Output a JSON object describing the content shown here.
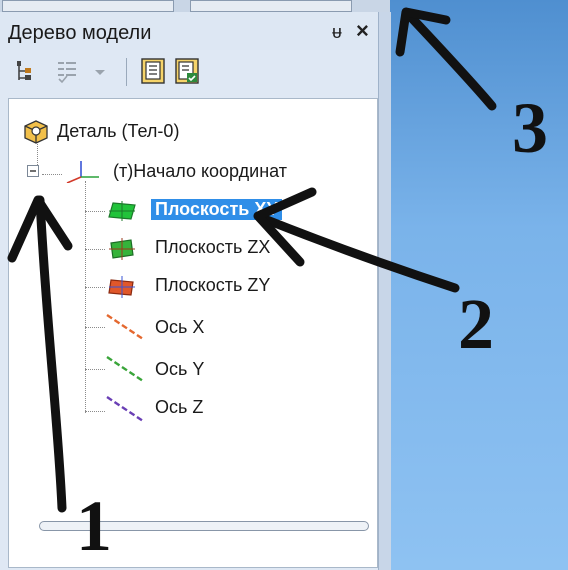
{
  "panel": {
    "title": "Дерево модели",
    "pin_glyph": "ᵾ",
    "close_glyph": "×"
  },
  "toolbar": {
    "icons": [
      "tree-structure-icon",
      "filter-list-icon",
      "dropdown-arrow-icon",
      "document-icon",
      "rebuild-icon"
    ]
  },
  "tree": {
    "root": {
      "label": "Деталь (Тел-0)",
      "icon": "part-cube-icon"
    },
    "origin": {
      "label": "(т)Начало координат",
      "icon": "axes-origin-icon"
    },
    "children": [
      {
        "label": "Плоскость XY",
        "icon": "plane-xy-icon",
        "color": "#21c33a",
        "selected": true
      },
      {
        "label": "Плоскость ZX",
        "icon": "plane-zx-icon",
        "color": "#35b33a",
        "selected": false
      },
      {
        "label": "Плоскость ZY",
        "icon": "plane-zy-icon",
        "color": "#e0572a",
        "selected": false
      },
      {
        "label": "Ось X",
        "icon": "axis-x-icon",
        "color": "#e4682f",
        "selected": false
      },
      {
        "label": "Ось Y",
        "icon": "axis-y-icon",
        "color": "#3aa53a",
        "selected": false
      },
      {
        "label": "Ось Z",
        "icon": "axis-z-icon",
        "color": "#6a3fb5",
        "selected": false
      }
    ]
  },
  "annotations": [
    "1",
    "2",
    "3"
  ],
  "colors": {
    "canvas": "#6aa6e3",
    "selection": "#2f8ee8"
  }
}
